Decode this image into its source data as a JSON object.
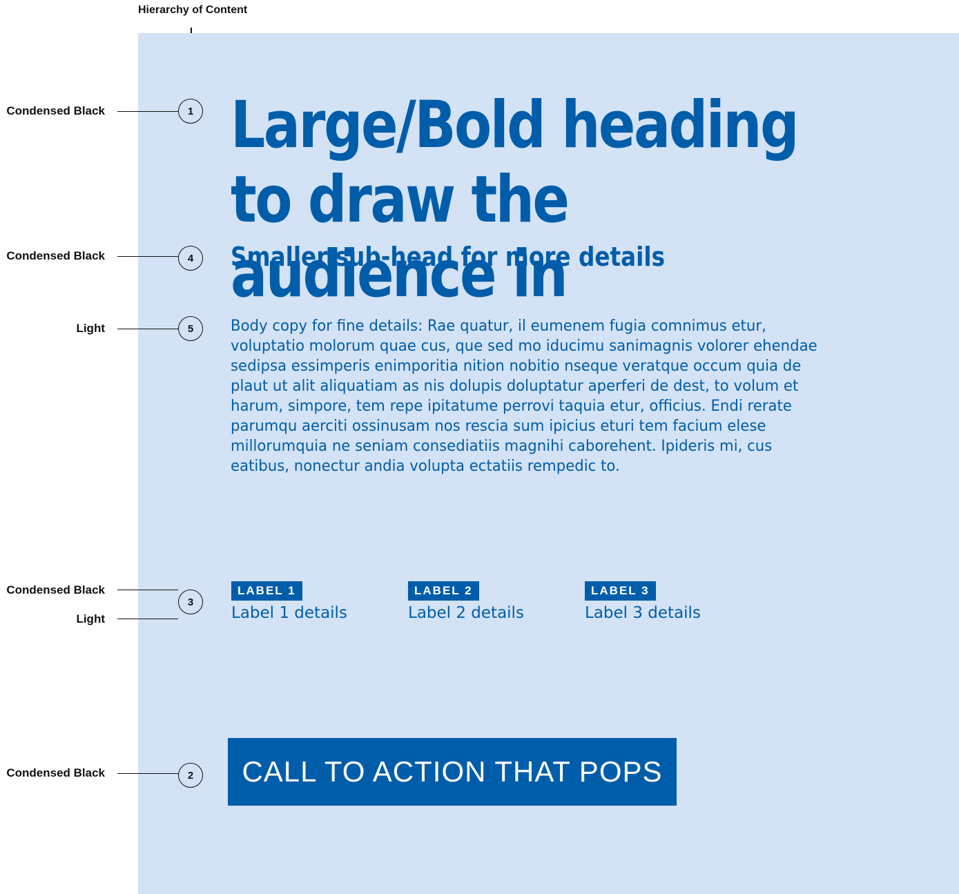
{
  "diagram_title": "Hierarchy of Content",
  "annotations": [
    {
      "number": "1",
      "font_labels": [
        "Condensed Black"
      ]
    },
    {
      "number": "4",
      "font_labels": [
        "Condensed Black"
      ]
    },
    {
      "number": "5",
      "font_labels": [
        "Light"
      ]
    },
    {
      "number": "3",
      "font_labels": [
        "Condensed Black",
        "Light"
      ]
    },
    {
      "number": "2",
      "font_labels": [
        "Condensed Black"
      ]
    }
  ],
  "content": {
    "heading": "Large/Bold heading to draw the audience in",
    "subhead": "Smaller sub-head for more details",
    "body": "Body copy for fine details: Rae quatur, il eumenem fugia comnimus etur, voluptatio molorum quae cus, que sed mo iducimu sanimagnis volorer ehendae sedipsa essimperis enimporitia nition nobitio nseque veratque occum quia de plaut ut alit aliquatiam as nis dolupis doluptatur aperferi de dest, to volum et harum, simpore, tem repe ipitatume perrovi taquia etur, officius. Endi rerate parumqu aerciti ossinusam nos rescia sum ipicius eturi tem facium elese millorumquia ne seniam consediatiis magnihi caborehent. Ipideris mi, cus eatibus, nonectur andia volupta ectatiis rempedic to.",
    "labels": [
      {
        "tag": "LABEL 1",
        "detail": "Label 1 details"
      },
      {
        "tag": "LABEL 2",
        "detail": "Label 2 details"
      },
      {
        "tag": "LABEL 3",
        "detail": "Label 3 details"
      }
    ],
    "cta": "CALL TO ACTION THAT POPS"
  },
  "colors": {
    "brand_blue": "#005daa",
    "panel_background": "#d3e2f4"
  }
}
